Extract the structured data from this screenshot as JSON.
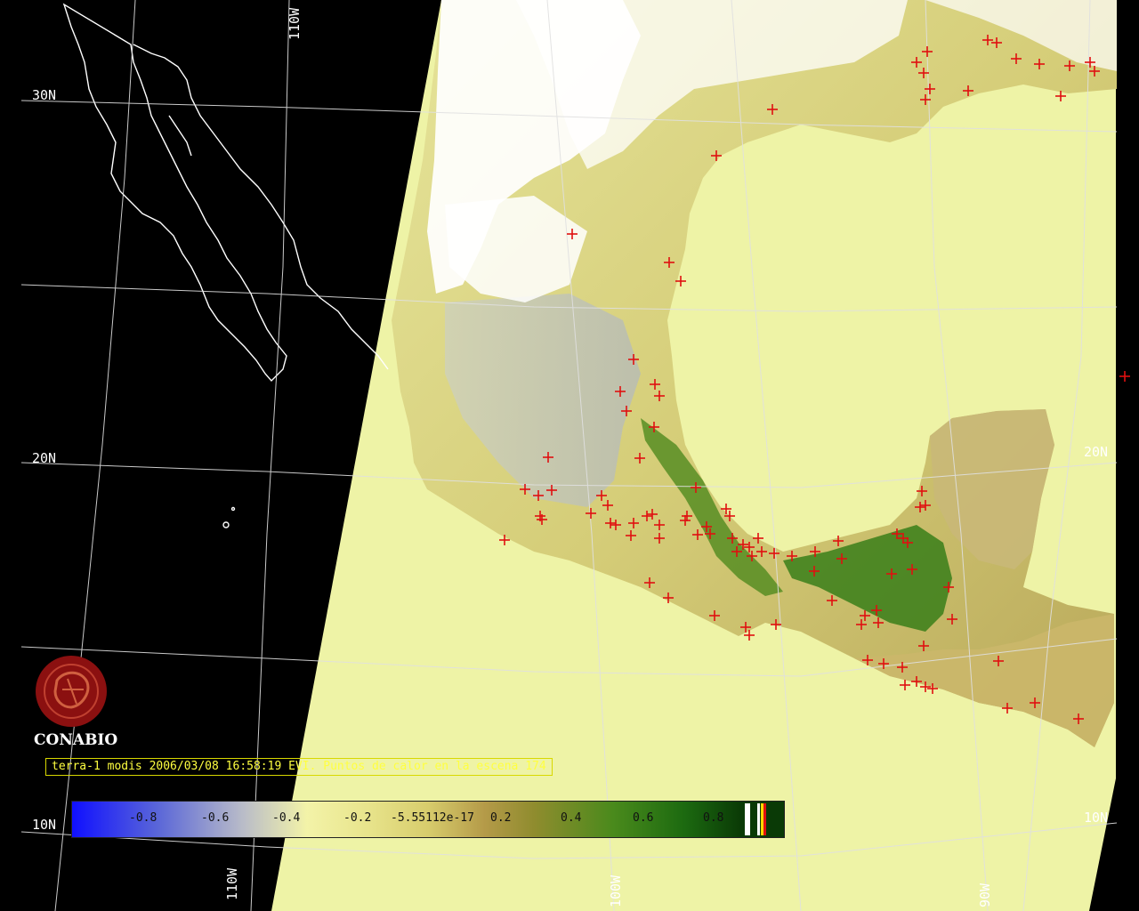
{
  "caption": "terra-1 modis 2006/03/08 16:58:19 EVI. Puntos de calor en la escena 174",
  "logo_text": "CONABIO",
  "grid_labels": {
    "lat_30_west": "30N",
    "lat_20_west": "20N",
    "lat_10_west": "10N",
    "lat_20_east": "20N",
    "lat_10_east": "10N",
    "lon_110_top": "110W",
    "lon_110_bottom": "110W",
    "lon_100_bottom": "100W",
    "lon_90_bottom": "90W"
  },
  "colorbar": {
    "ticks": [
      "-0.8",
      "-0.6",
      "-0.4",
      "-0.2",
      "-5.55112e-17",
      "0.2",
      "0.4",
      "0.6",
      "0.8"
    ]
  },
  "colors": {
    "no_data_background": "#000000",
    "ocean_fill": "#eef3a6",
    "cloud": "#ffffff",
    "fire_marker": "#e01010",
    "caption_text": "#ffff40",
    "logo": "#8b1010"
  }
}
